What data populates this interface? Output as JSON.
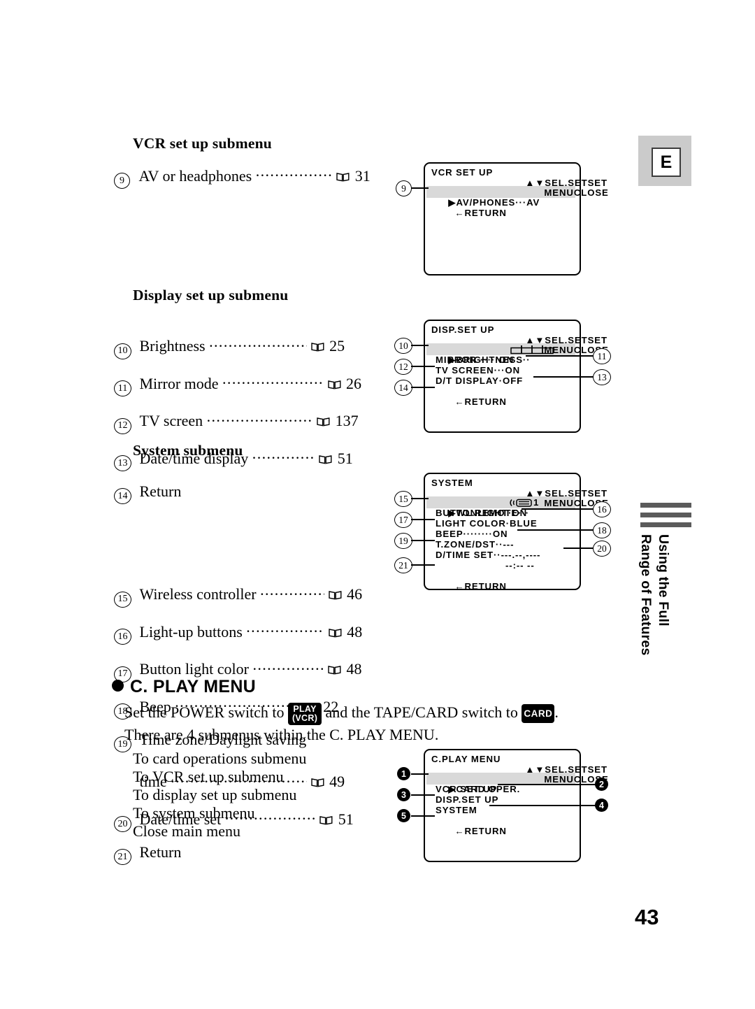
{
  "page": {
    "number": "43",
    "lang_tab": "E",
    "side_title": "Using the Full\nRange of Features"
  },
  "sections": [
    {
      "id": "vcr-set-up",
      "heading": "VCR set up submenu",
      "items": [
        {
          "num": "9",
          "label": "AV or headphones",
          "page": "31"
        }
      ]
    },
    {
      "id": "display-set-up",
      "heading": "Display set up submenu",
      "items": [
        {
          "num": "10",
          "label": "Brightness",
          "page": "25"
        },
        {
          "num": "11",
          "label": "Mirror mode",
          "page": "26"
        },
        {
          "num": "12",
          "label": "TV screen",
          "page": "137"
        },
        {
          "num": "13",
          "label": "Date/time display",
          "page": "51"
        },
        {
          "num": "14",
          "label": "Return",
          "page": ""
        }
      ]
    },
    {
      "id": "system",
      "heading": "System submenu",
      "items": [
        {
          "num": "15",
          "label": "Wireless controller",
          "page": "46"
        },
        {
          "num": "16",
          "label": "Light-up buttons",
          "page": "48"
        },
        {
          "num": "17",
          "label": "Button light color",
          "page": "48"
        },
        {
          "num": "18",
          "label": "Beep",
          "page": "22"
        },
        {
          "num": "19",
          "label": "Time zone/Daylight saving",
          "page": ""
        },
        {
          "num": "",
          "label": "time",
          "page": "49"
        },
        {
          "num": "20",
          "label": "Date/time set",
          "page": "51"
        },
        {
          "num": "21",
          "label": "Return",
          "page": ""
        }
      ]
    }
  ],
  "c_play": {
    "bullet_heading": "C. PLAY MENU",
    "line1_a": "Set the POWER switch to",
    "key_play_top": "PLAY",
    "key_play_bottom": "(VCR)",
    "line1_b": "and the TAPE/CARD switch to",
    "key_card": "CARD",
    "line1_c": ".",
    "line2": "There are 4 submenus within the C. PLAY MENU.",
    "routes": [
      "To card operations submenu",
      "To VCR set up submenu",
      "To display set up submenu",
      "To system submenu",
      "Close main menu"
    ]
  },
  "lcd_screens": {
    "vcr_set_up": {
      "title": "VCR SET UP",
      "hint_sel": "SEL.SET",
      "hint_set": "SET",
      "hint_menu": "MENU",
      "hint_close": "CLOSE",
      "rows": [
        {
          "cursor": "▶",
          "text": "AV/PHONES···AV",
          "highlight": true
        },
        {
          "cursor": "←",
          "text": "RETURN",
          "highlight": false
        }
      ],
      "callouts": [
        {
          "num": "9",
          "side": "left",
          "row": 0
        }
      ]
    },
    "disp_set_up": {
      "title": "DISP.SET UP",
      "hint_sel": "SEL.SET",
      "hint_set": "SET",
      "hint_menu": "MENU",
      "hint_close": "CLOSE",
      "rows": [
        {
          "cursor": "▶",
          "text": "BRIGHTNESS··",
          "slider": true,
          "highlight": true
        },
        {
          "cursor": "",
          "text": "MIRROR······ON",
          "highlight": false
        },
        {
          "cursor": "",
          "text": "TV SCREEN···ON",
          "highlight": false
        },
        {
          "cursor": "",
          "text": "D/T DISPLAY·OFF",
          "highlight": false
        },
        {
          "cursor": "←",
          "text": "RETURN",
          "highlight": false
        }
      ],
      "callouts": [
        {
          "num": "10",
          "side": "left"
        },
        {
          "num": "11",
          "side": "right"
        },
        {
          "num": "12",
          "side": "left"
        },
        {
          "num": "13",
          "side": "right"
        },
        {
          "num": "14",
          "side": "left"
        }
      ]
    },
    "system": {
      "title": "SYSTEM",
      "hint_sel": "SEL.SET",
      "hint_set": "SET",
      "hint_menu": "MENU",
      "hint_close": "CLOSE",
      "rows": [
        {
          "cursor": "▶",
          "text": "WL.REMOTE···",
          "remote_icon": true,
          "value": "1",
          "highlight": true
        },
        {
          "cursor": "",
          "text": "BUTTONLIGHT·ON",
          "highlight": false
        },
        {
          "cursor": "",
          "text": "LIGHT COLOR·BLUE",
          "highlight": false
        },
        {
          "cursor": "",
          "text": "BEEP········ON",
          "highlight": false
        },
        {
          "cursor": "",
          "text": "T.ZONE/DST··---",
          "highlight": false
        },
        {
          "cursor": "",
          "text": "D/TIME SET··---.--,----",
          "highlight": false
        },
        {
          "cursor": "",
          "text": "--:-- --",
          "indent": true,
          "highlight": false
        },
        {
          "cursor": "←",
          "text": "RETURN",
          "highlight": false
        }
      ],
      "callouts": [
        {
          "num": "15",
          "side": "left"
        },
        {
          "num": "16",
          "side": "right"
        },
        {
          "num": "17",
          "side": "left"
        },
        {
          "num": "18",
          "side": "right"
        },
        {
          "num": "19",
          "side": "left"
        },
        {
          "num": "20",
          "side": "right"
        },
        {
          "num": "21",
          "side": "left"
        }
      ]
    },
    "c_play_menu": {
      "title": "C.PLAY MENU",
      "hint_sel": "SEL.SET",
      "hint_set": "SET",
      "hint_menu": "MENU",
      "hint_close": "CLOSE",
      "rows": [
        {
          "cursor": "▶",
          "text": "CARD OPER.",
          "highlight": true
        },
        {
          "cursor": "",
          "text": "VCR SET UP",
          "highlight": false
        },
        {
          "cursor": "",
          "text": "DISP.SET UP",
          "highlight": false
        },
        {
          "cursor": "",
          "text": "SYSTEM",
          "highlight": false
        },
        {
          "cursor": "←",
          "text": "RETURN",
          "highlight": false
        }
      ],
      "callouts": [
        {
          "num": "1",
          "side": "left"
        },
        {
          "num": "2",
          "side": "right"
        },
        {
          "num": "3",
          "side": "left"
        },
        {
          "num": "4",
          "side": "right"
        },
        {
          "num": "5",
          "side": "left"
        }
      ]
    }
  }
}
